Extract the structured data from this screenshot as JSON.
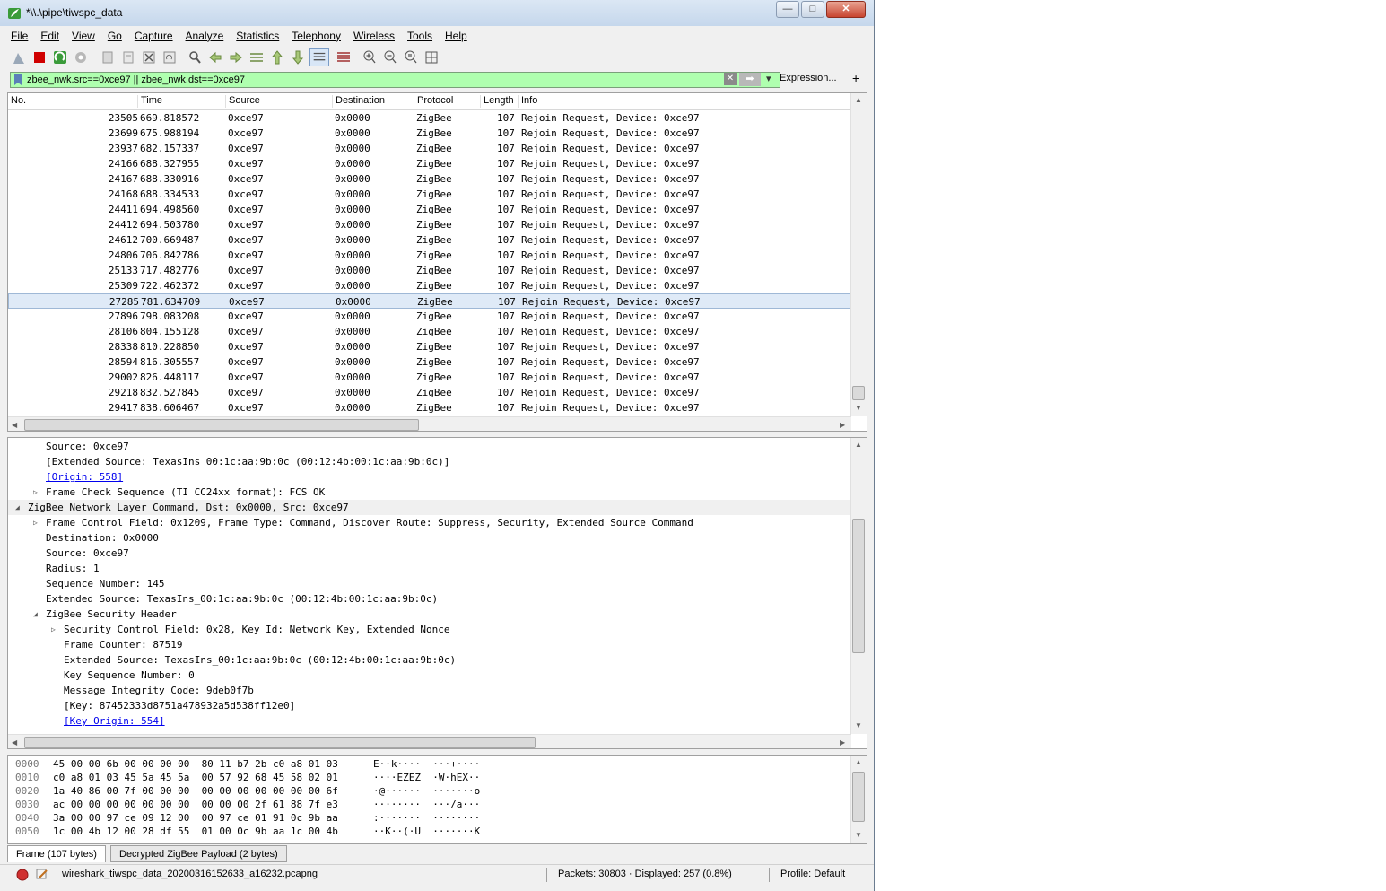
{
  "window": {
    "title": "*\\\\.\\pipe\\tiwspc_data",
    "minimize": "—",
    "maximize": "□",
    "close": "✕"
  },
  "menu": [
    "File",
    "Edit",
    "View",
    "Go",
    "Capture",
    "Analyze",
    "Statistics",
    "Telephony",
    "Wireless",
    "Tools",
    "Help"
  ],
  "toolbar_icons": [
    "shark-fin-start-icon",
    "stop-capture-icon",
    "restart-capture-icon",
    "capture-options-icon",
    "open-file-icon",
    "save-file-icon",
    "close-file-icon",
    "reload-file-icon",
    "find-packet-icon",
    "go-back-icon",
    "go-forward-icon",
    "go-to-packet-icon",
    "first-packet-icon",
    "last-packet-icon",
    "autoscroll-icon",
    "colorize-icon",
    "zoom-in-icon",
    "zoom-out-icon",
    "normal-size-icon",
    "resize-columns-icon"
  ],
  "filter": {
    "value": "zbee_nwk.src==0xce97 || zbee_nwk.dst==0xce97",
    "expression_label": "Expression...",
    "plus": "+",
    "clear": "✕",
    "apply": "➡",
    "dropdown": "▾"
  },
  "columns": [
    "No.",
    "Time",
    "Source",
    "Destination",
    "Protocol",
    "Length",
    "Info"
  ],
  "packets": [
    {
      "no": "23505",
      "time": "669.818572",
      "src": "0xce97",
      "dst": "0x0000",
      "proto": "ZigBee",
      "len": "107",
      "info": "Rejoin Request, Device: 0xce97"
    },
    {
      "no": "23699",
      "time": "675.988194",
      "src": "0xce97",
      "dst": "0x0000",
      "proto": "ZigBee",
      "len": "107",
      "info": "Rejoin Request, Device: 0xce97"
    },
    {
      "no": "23937",
      "time": "682.157337",
      "src": "0xce97",
      "dst": "0x0000",
      "proto": "ZigBee",
      "len": "107",
      "info": "Rejoin Request, Device: 0xce97"
    },
    {
      "no": "24166",
      "time": "688.327955",
      "src": "0xce97",
      "dst": "0x0000",
      "proto": "ZigBee",
      "len": "107",
      "info": "Rejoin Request, Device: 0xce97"
    },
    {
      "no": "24167",
      "time": "688.330916",
      "src": "0xce97",
      "dst": "0x0000",
      "proto": "ZigBee",
      "len": "107",
      "info": "Rejoin Request, Device: 0xce97"
    },
    {
      "no": "24168",
      "time": "688.334533",
      "src": "0xce97",
      "dst": "0x0000",
      "proto": "ZigBee",
      "len": "107",
      "info": "Rejoin Request, Device: 0xce97"
    },
    {
      "no": "24411",
      "time": "694.498560",
      "src": "0xce97",
      "dst": "0x0000",
      "proto": "ZigBee",
      "len": "107",
      "info": "Rejoin Request, Device: 0xce97"
    },
    {
      "no": "24412",
      "time": "694.503780",
      "src": "0xce97",
      "dst": "0x0000",
      "proto": "ZigBee",
      "len": "107",
      "info": "Rejoin Request, Device: 0xce97"
    },
    {
      "no": "24612",
      "time": "700.669487",
      "src": "0xce97",
      "dst": "0x0000",
      "proto": "ZigBee",
      "len": "107",
      "info": "Rejoin Request, Device: 0xce97"
    },
    {
      "no": "24806",
      "time": "706.842786",
      "src": "0xce97",
      "dst": "0x0000",
      "proto": "ZigBee",
      "len": "107",
      "info": "Rejoin Request, Device: 0xce97"
    },
    {
      "no": "25133",
      "time": "717.482776",
      "src": "0xce97",
      "dst": "0x0000",
      "proto": "ZigBee",
      "len": "107",
      "info": "Rejoin Request, Device: 0xce97"
    },
    {
      "no": "25309",
      "time": "722.462372",
      "src": "0xce97",
      "dst": "0x0000",
      "proto": "ZigBee",
      "len": "107",
      "info": "Rejoin Request, Device: 0xce97"
    },
    {
      "no": "27285",
      "time": "781.634709",
      "src": "0xce97",
      "dst": "0x0000",
      "proto": "ZigBee",
      "len": "107",
      "info": "Rejoin Request, Device: 0xce97",
      "selected": true
    },
    {
      "no": "27896",
      "time": "798.083208",
      "src": "0xce97",
      "dst": "0x0000",
      "proto": "ZigBee",
      "len": "107",
      "info": "Rejoin Request, Device: 0xce97"
    },
    {
      "no": "28106",
      "time": "804.155128",
      "src": "0xce97",
      "dst": "0x0000",
      "proto": "ZigBee",
      "len": "107",
      "info": "Rejoin Request, Device: 0xce97"
    },
    {
      "no": "28338",
      "time": "810.228850",
      "src": "0xce97",
      "dst": "0x0000",
      "proto": "ZigBee",
      "len": "107",
      "info": "Rejoin Request, Device: 0xce97"
    },
    {
      "no": "28594",
      "time": "816.305557",
      "src": "0xce97",
      "dst": "0x0000",
      "proto": "ZigBee",
      "len": "107",
      "info": "Rejoin Request, Device: 0xce97"
    },
    {
      "no": "29002",
      "time": "826.448117",
      "src": "0xce97",
      "dst": "0x0000",
      "proto": "ZigBee",
      "len": "107",
      "info": "Rejoin Request, Device: 0xce97"
    },
    {
      "no": "29218",
      "time": "832.527845",
      "src": "0xce97",
      "dst": "0x0000",
      "proto": "ZigBee",
      "len": "107",
      "info": "Rejoin Request, Device: 0xce97"
    },
    {
      "no": "29417",
      "time": "838.606467",
      "src": "0xce97",
      "dst": "0x0000",
      "proto": "ZigBee",
      "len": "107",
      "info": "Rejoin Request, Device: 0xce97"
    }
  ],
  "details": [
    {
      "indent": 2,
      "text": "Source: 0xce97"
    },
    {
      "indent": 2,
      "text": "[Extended Source: TexasIns_00:1c:aa:9b:0c (00:12:4b:00:1c:aa:9b:0c)]"
    },
    {
      "indent": 2,
      "text": "[Origin: 558]",
      "link": true
    },
    {
      "indent": 1,
      "tri": "▷",
      "text": "Frame Check Sequence (TI CC24xx format): FCS OK"
    },
    {
      "indent": 0,
      "tri": "◢",
      "text": "ZigBee Network Layer Command, Dst: 0x0000, Src: 0xce97",
      "hl": true
    },
    {
      "indent": 1,
      "tri": "▷",
      "text": "Frame Control Field: 0x1209, Frame Type: Command, Discover Route: Suppress, Security, Extended Source Command"
    },
    {
      "indent": 2,
      "text": "Destination: 0x0000"
    },
    {
      "indent": 2,
      "text": "Source: 0xce97"
    },
    {
      "indent": 2,
      "text": "Radius: 1"
    },
    {
      "indent": 2,
      "text": "Sequence Number: 145"
    },
    {
      "indent": 2,
      "text": "Extended Source: TexasIns_00:1c:aa:9b:0c (00:12:4b:00:1c:aa:9b:0c)"
    },
    {
      "indent": 1,
      "tri": "◢",
      "text": "ZigBee Security Header"
    },
    {
      "indent": 2,
      "tri": "▷",
      "text": "Security Control Field: 0x28, Key Id: Network Key, Extended Nonce"
    },
    {
      "indent": 3,
      "text": "Frame Counter: 87519"
    },
    {
      "indent": 3,
      "text": "Extended Source: TexasIns_00:1c:aa:9b:0c (00:12:4b:00:1c:aa:9b:0c)"
    },
    {
      "indent": 3,
      "text": "Key Sequence Number: 0"
    },
    {
      "indent": 3,
      "text": "Message Integrity Code: 9deb0f7b"
    },
    {
      "indent": 3,
      "text": "[Key: 87452333d8751a478932a5d538ff12e0]"
    },
    {
      "indent": 3,
      "text": "[Key Origin: 554]",
      "link": true
    }
  ],
  "bytes": [
    {
      "off": "0000",
      "hex": "45 00 00 6b 00 00 00 00  80 11 b7 2b c0 a8 01 03",
      "asc": "E··k····  ···+····"
    },
    {
      "off": "0010",
      "hex": "c0 a8 01 03 45 5a 45 5a  00 57 92 68 45 58 02 01",
      "asc": "····EZEZ  ·W·hEX··"
    },
    {
      "off": "0020",
      "hex": "1a 40 86 00 7f 00 00 00  00 00 00 00 00 00 00 6f",
      "asc": "·@······  ·······o"
    },
    {
      "off": "0030",
      "hex": "ac 00 00 00 00 00 00 00  00 00 00 2f 61 88 7f e3",
      "asc": "········  ···/a···"
    },
    {
      "off": "0040",
      "hex": "3a 00 00 97 ce 09 12 00  00 97 ce 01 91 0c 9b aa",
      "asc": ":·······  ········"
    },
    {
      "off": "0050",
      "hex": "1c 00 4b 12 00 28 df 55  01 00 0c 9b aa 1c 00 4b",
      "asc": "··K··(·U  ·······K"
    }
  ],
  "byte_tabs": [
    "Frame (107 bytes)",
    "Decrypted ZigBee Payload (2 bytes)"
  ],
  "status": {
    "file": "wireshark_tiwspc_data_20200316152633_a16232.pcapng",
    "packets": "Packets: 30803 · Displayed: 257 (0.8%)",
    "profile": "Profile: Default"
  },
  "colors": {
    "filter_valid_bg": "#afffaf",
    "selected_row_bg": "#dfeaf7",
    "stop_red": "#d00000"
  }
}
